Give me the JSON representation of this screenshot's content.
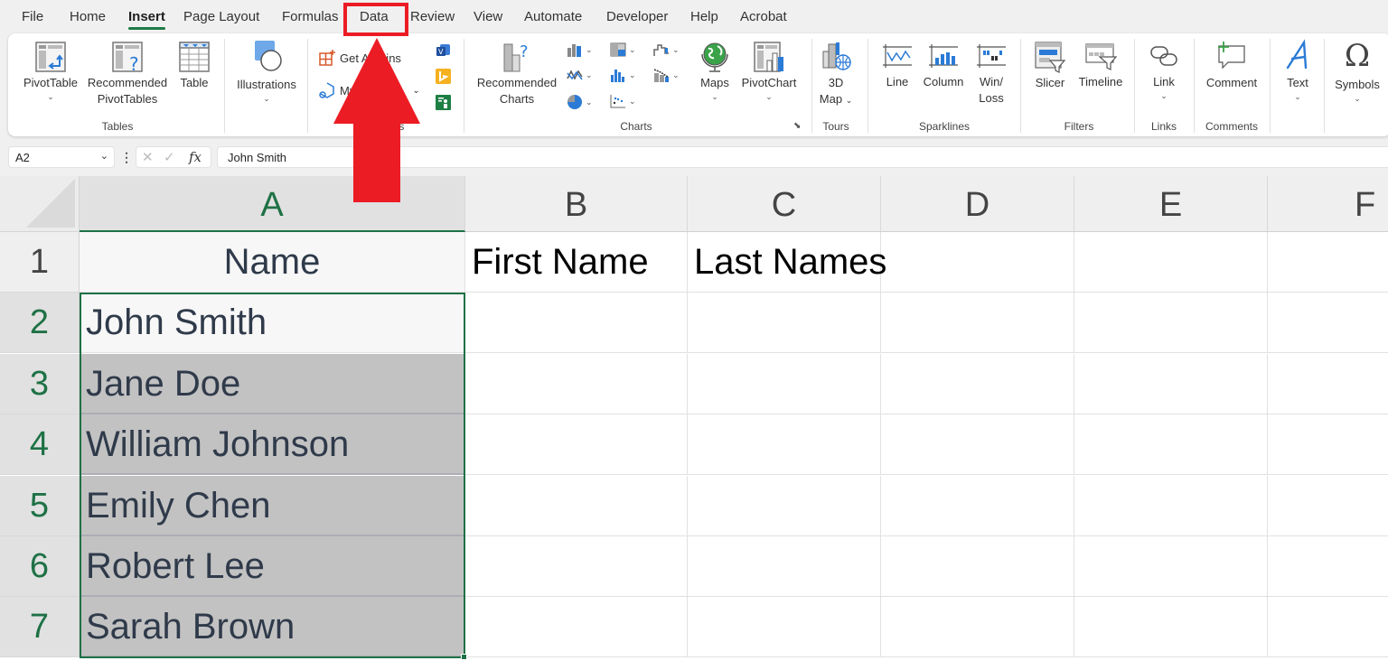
{
  "menu": {
    "tabs": [
      {
        "label": "File",
        "active": false
      },
      {
        "label": "Home",
        "active": false
      },
      {
        "label": "Insert",
        "active": true
      },
      {
        "label": "Page Layout",
        "active": false
      },
      {
        "label": "Formulas",
        "active": false
      },
      {
        "label": "Data",
        "active": false,
        "highlighted": true
      },
      {
        "label": "Review",
        "active": false
      },
      {
        "label": "View",
        "active": false
      },
      {
        "label": "Automate",
        "active": false
      },
      {
        "label": "Developer",
        "active": false
      },
      {
        "label": "Help",
        "active": false
      },
      {
        "label": "Acrobat",
        "active": false
      }
    ]
  },
  "ribbon": {
    "tables": {
      "group_label": "Tables",
      "pivottable": "PivotTable",
      "recommended_pivottables_1": "Recommended",
      "recommended_pivottables_2": "PivotTables",
      "table": "Table"
    },
    "illustrations": {
      "label": "Illustrations"
    },
    "addins": {
      "group_label": "Add-ins",
      "get_addins": "Get Add-ins",
      "my_addins": "My Add-ins"
    },
    "charts": {
      "group_label": "Charts",
      "recommended_1": "Recommended",
      "recommended_2": "Charts",
      "maps": "Maps",
      "pivotchart": "PivotChart"
    },
    "tours": {
      "group_label": "Tours",
      "map_1": "3D",
      "map_2": "Map"
    },
    "sparklines": {
      "group_label": "Sparklines",
      "line": "Line",
      "column": "Column",
      "winloss_1": "Win/",
      "winloss_2": "Loss"
    },
    "filters": {
      "group_label": "Filters",
      "slicer": "Slicer",
      "timeline": "Timeline"
    },
    "links": {
      "group_label": "Links",
      "link": "Link"
    },
    "comments": {
      "group_label": "Comments",
      "comment": "Comment"
    },
    "text": {
      "label": "Text"
    },
    "symbols": {
      "label": "Symbols"
    }
  },
  "formula_bar": {
    "name_box": "A2",
    "fx": "fx",
    "formula": "John Smith"
  },
  "sheet": {
    "columns": [
      "A",
      "B",
      "C",
      "D",
      "E",
      "F"
    ],
    "selected_column": "A",
    "rows": [
      {
        "num": "1",
        "A": "Name",
        "B": "First Name",
        "C": "Last Names"
      },
      {
        "num": "2",
        "A": "John Smith",
        "B": "",
        "C": ""
      },
      {
        "num": "3",
        "A": "Jane Doe",
        "B": "",
        "C": ""
      },
      {
        "num": "4",
        "A": "William Johnson",
        "B": "",
        "C": ""
      },
      {
        "num": "5",
        "A": "Emily Chen",
        "B": "",
        "C": ""
      },
      {
        "num": "6",
        "A": "Robert Lee",
        "B": "",
        "C": ""
      },
      {
        "num": "7",
        "A": "Sarah Brown",
        "B": "",
        "C": ""
      }
    ],
    "selection": "A2:A7",
    "active_cell": "A2"
  },
  "annotation": {
    "target": "Data",
    "color": "#ec1c24"
  },
  "colors": {
    "accent_green": "#1e7145",
    "selection_fill": "#c2c2c2",
    "annotation_red": "#ec1c24"
  }
}
